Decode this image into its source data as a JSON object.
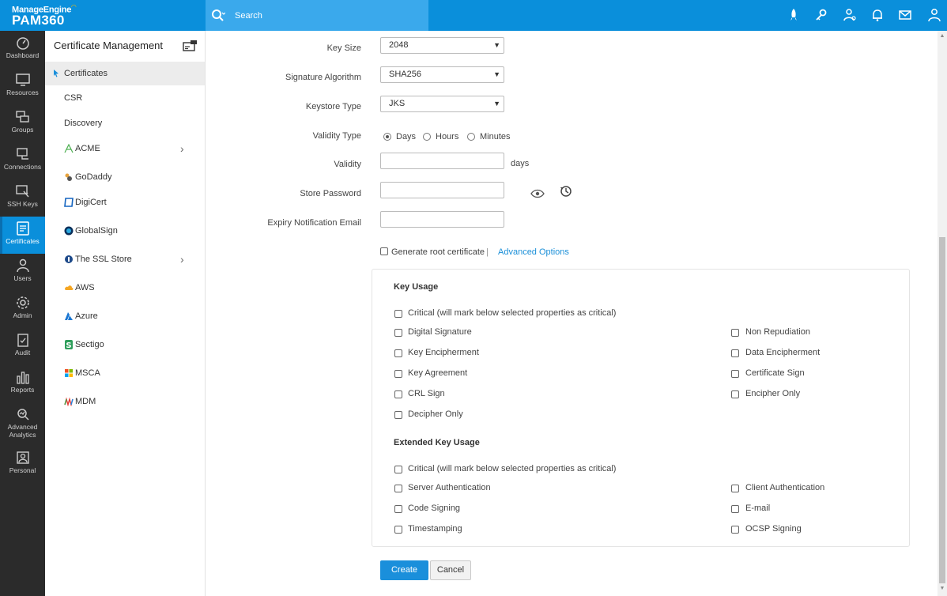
{
  "brand": {
    "vendor": "ManageEngine",
    "product": "PAM360"
  },
  "search": {
    "placeholder": "Search"
  },
  "topbar_icons": [
    "rocket-icon",
    "key-link-icon",
    "user-settings-icon",
    "bell-icon",
    "mail-icon",
    "user-icon"
  ],
  "nav": {
    "items": [
      {
        "label": "Dashboard",
        "icon": "dashboard-icon"
      },
      {
        "label": "Resources",
        "icon": "monitor-icon"
      },
      {
        "label": "Groups",
        "icon": "groups-icon"
      },
      {
        "label": "Connections",
        "icon": "connections-icon"
      },
      {
        "label": "SSH Keys",
        "icon": "ssh-key-icon"
      },
      {
        "label": "Certificates",
        "icon": "certificate-icon"
      },
      {
        "label": "Users",
        "icon": "users-icon"
      },
      {
        "label": "Admin",
        "icon": "gear-icon"
      },
      {
        "label": "Audit",
        "icon": "clipboard-icon"
      },
      {
        "label": "Reports",
        "icon": "bar-chart-icon"
      },
      {
        "label": "Advanced",
        "label2": "Analytics",
        "icon": "analytics-icon"
      },
      {
        "label": "Personal",
        "icon": "personal-icon"
      }
    ]
  },
  "sidebar": {
    "title": "Certificate Management",
    "items": [
      {
        "label": "Certificates"
      },
      {
        "label": "CSR"
      },
      {
        "label": "Discovery"
      },
      {
        "label": "ACME"
      },
      {
        "label": "GoDaddy"
      },
      {
        "label": "DigiCert"
      },
      {
        "label": "GlobalSign"
      },
      {
        "label": "The SSL Store"
      },
      {
        "label": "AWS"
      },
      {
        "label": "Azure"
      },
      {
        "label": "Sectigo"
      },
      {
        "label": "MSCA"
      },
      {
        "label": "MDM"
      }
    ]
  },
  "form": {
    "key_size": {
      "label": "Key Size",
      "value": "2048"
    },
    "signature_algorithm": {
      "label": "Signature Algorithm",
      "value": "SHA256"
    },
    "keystore_type": {
      "label": "Keystore Type",
      "value": "JKS"
    },
    "validity_type": {
      "label": "Validity Type",
      "options": [
        "Days",
        "Hours",
        "Minutes"
      ],
      "selected": "Days"
    },
    "validity": {
      "label": "Validity",
      "value": "",
      "unit": "days"
    },
    "store_password": {
      "label": "Store Password",
      "value": ""
    },
    "expiry_email": {
      "label": "Expiry Notification Email",
      "value": ""
    },
    "generate_root": {
      "label": "Generate root certificate",
      "separator": "|",
      "checked": false
    },
    "advanced_options": "Advanced Options"
  },
  "key_usage": {
    "title": "Key Usage",
    "critical": "Critical (will mark below selected properties as critical)",
    "left": [
      "Digital Signature",
      "Key Encipherment",
      "Key Agreement",
      "CRL Sign",
      "Decipher Only"
    ],
    "right": [
      "Non Repudiation",
      "Data Encipherment",
      "Certificate Sign",
      "Encipher Only"
    ]
  },
  "extended_key_usage": {
    "title": "Extended Key Usage",
    "critical": "Critical (will mark below selected properties as critical)",
    "left": [
      "Server Authentication",
      "Code Signing",
      "Timestamping"
    ],
    "right": [
      "Client Authentication",
      "E-mail",
      "OCSP Signing"
    ]
  },
  "actions": {
    "create": "Create",
    "cancel": "Cancel"
  },
  "colors": {
    "accent": "#0a8fdb",
    "nav_bg": "#2b2b2b",
    "link": "#1a8fd8"
  }
}
